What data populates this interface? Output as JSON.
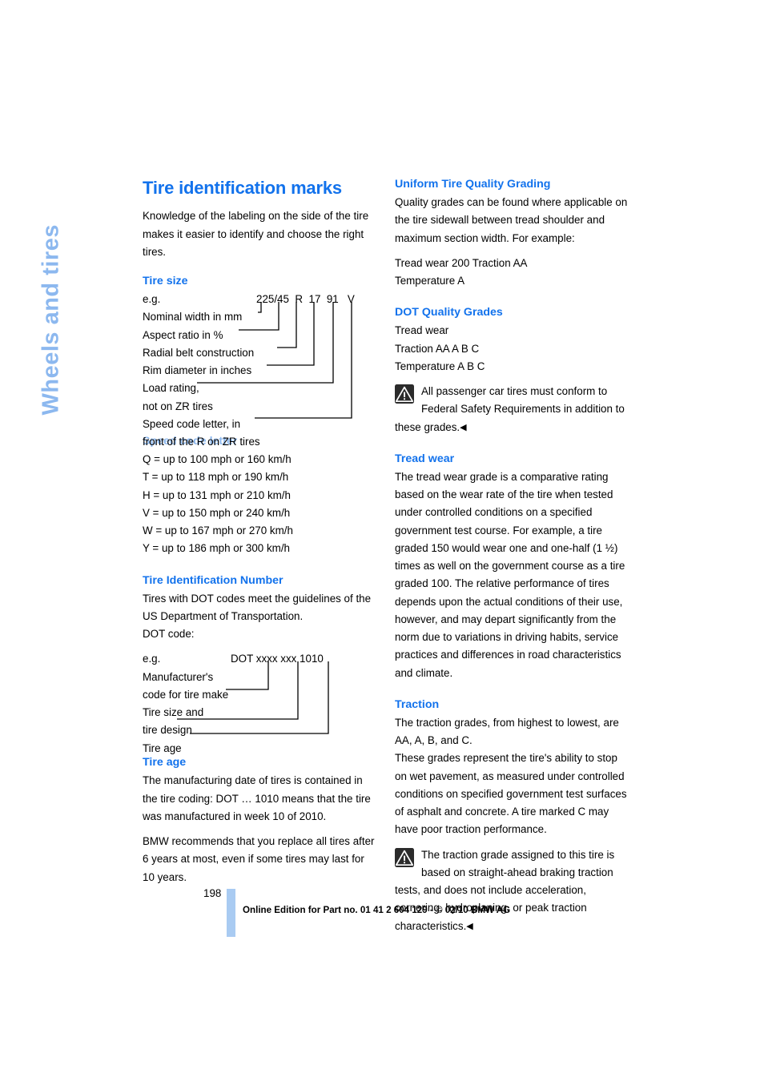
{
  "chapter_tab": "Wheels and tires",
  "page_number": "198",
  "footer_text": "Online Edition for Part no. 01 41 2 604 129 - © 02/10 BMW AG",
  "icons": {
    "warning": "warning-triangle-icon",
    "endmark": "◀"
  },
  "colors": {
    "heading_blue": "#1272ec",
    "light_blue": "#8cb8ef",
    "footer_bar": "#a9cbf2",
    "body_text": "#000000"
  },
  "left_column": {
    "title": "Tire identification marks",
    "intro": "Knowledge of the labeling on the side of the tire makes it easier to identify and choose the right tires.",
    "tire_size": {
      "heading": "Tire size",
      "eg_label": "e.g.",
      "sample": "225/45  R  17  91   V",
      "sample_parts": [
        "225/45",
        "R",
        "17",
        "91",
        "V"
      ],
      "callouts": [
        "Nominal width in mm",
        "Aspect ratio in %",
        "Radial belt construction",
        "Rim diameter in inches",
        "Load rating,",
        "not on ZR tires",
        "Speed code letter, in",
        "front of the R on ZR tires"
      ]
    },
    "speed_code": {
      "heading": "Speed code letter",
      "rows": [
        "Q = up to 100 mph or 160 km/h",
        "T = up to 118 mph or 190 km/h",
        "H = up to 131 mph or 210 km/h",
        "V = up to 150 mph or 240 km/h",
        "W = up to 167 mph or 270 km/h",
        "Y = up to 186 mph or 300 km/h"
      ]
    },
    "tin": {
      "heading": "Tire Identification Number",
      "intro": "Tires with DOT codes meet the guidelines of the US Department of Transportation.",
      "dot_code_label": "DOT code:",
      "eg_label": "e.g.",
      "sample": "DOT xxxx xxx 1010",
      "callouts": [
        "Manufacturer's",
        "code for tire make",
        "Tire size and",
        "tire design",
        "Tire age"
      ]
    },
    "tire_age": {
      "heading": "Tire age",
      "paragraphs": [
        "The manufacturing date of tires is contained in the tire coding: DOT … 1010 means that the tire was manufactured in week 10 of 2010.",
        "BMW recommends that you replace all tires after 6 years at most, even if some tires may last for 10 years."
      ]
    }
  },
  "right_column": {
    "utqg": {
      "heading": "Uniform Tire Quality Grading",
      "intro": "Quality grades can be found where applicable on the tire sidewall between tread shoulder and maximum section width. For example:",
      "example_lines": [
        "Tread wear 200 Traction AA",
        "Temperature A"
      ]
    },
    "dot_grades": {
      "heading": "DOT Quality Grades",
      "rows": [
        "Tread wear",
        "Traction AA A B C",
        "Temperature A B C"
      ],
      "note": "All passenger car tires must conform to Federal Safety Requirements in addition to these grades."
    },
    "tread_wear": {
      "heading": "Tread wear",
      "paragraph": "The tread wear grade is a comparative rating based on the wear rate of the tire when tested under controlled conditions on a specified government test course. For example, a tire graded 150 would wear one and one-half (1 ½) times as well on the government course as a tire graded 100. The relative performance of tires depends upon the actual conditions of their use, however, and may depart significantly from the norm due to variations in driving habits, service practices and differences in road characteristics and climate."
    },
    "traction": {
      "heading": "Traction",
      "paragraph_1": "The traction grades, from highest to lowest, are AA, A, B, and C.",
      "paragraph_2": "These grades represent the tire's ability to stop on wet pavement, as measured under controlled conditions on specified government test surfaces of asphalt and concrete. A tire marked C may have poor traction performance.",
      "note": "The traction grade assigned to this tire is based on straight-ahead braking traction tests, and does not include acceleration, cornering, hydroplaning, or peak traction characteristics."
    }
  }
}
